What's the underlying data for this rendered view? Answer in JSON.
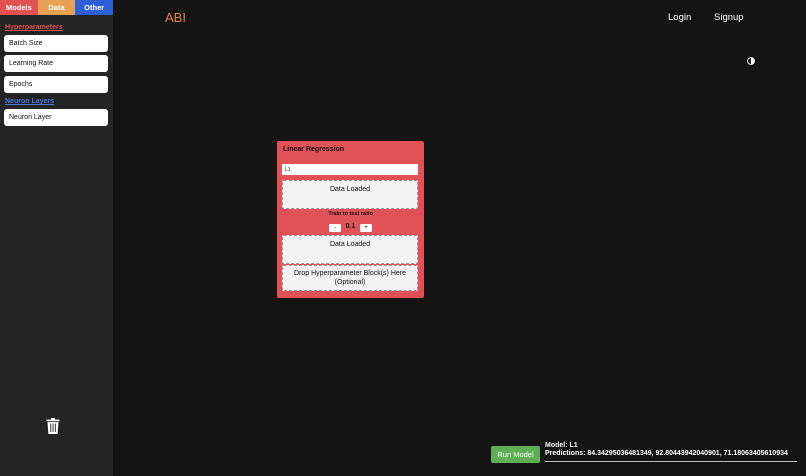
{
  "sidebar": {
    "tabs": [
      {
        "label": "Models"
      },
      {
        "label": "Data"
      },
      {
        "label": "Other"
      }
    ],
    "hyperparameters": {
      "title": "Hyperparameters",
      "items": [
        "Batch Size",
        "Learning Rate",
        "Epochs"
      ]
    },
    "neuron_layers": {
      "title": "Neuron Layers",
      "items": [
        "Neuron Layer"
      ]
    },
    "trash_icon": "trash-icon"
  },
  "header": {
    "brand": "ABI",
    "login": "Login",
    "signup": "Signup",
    "theme_icon": "half-circle-contrast-icon"
  },
  "model_card": {
    "title": "Linear Regression",
    "name_value": "L1",
    "data_slot_1": "Data Loaded",
    "ratio_label": "Train to test ratio",
    "ratio_minus": "-",
    "ratio_value": "0.1",
    "ratio_plus": "+",
    "data_slot_2": "Data Loaded",
    "hyper_drop": "Drop Hyperparameter Block(s) Here (Optional)"
  },
  "footer": {
    "run_button": "Run Model",
    "model_line": "Model: L1",
    "predictions_line": "Predictions: 84.34295036481349, 92.80443942040901, 71.18063405610934"
  },
  "colors": {
    "models_tab": "#e05252",
    "data_tab": "#e8a052",
    "other_tab": "#2e5fd6",
    "brand": "#e8823c",
    "card": "#e05257",
    "run_button": "#5fae55"
  }
}
